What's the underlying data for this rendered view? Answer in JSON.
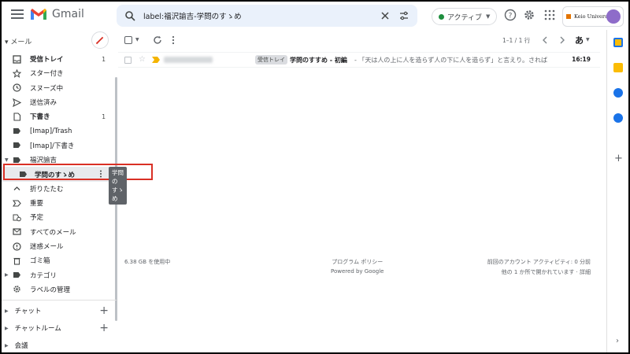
{
  "app": {
    "name": "Gmail"
  },
  "search": {
    "query": "label:福沢諭吉-学問のすゝめ"
  },
  "status": {
    "label": "アクティブ"
  },
  "account": {
    "org": "Keio University"
  },
  "sidebar": {
    "mail_label": "メール",
    "items": [
      {
        "label": "受信トレイ",
        "count": "1",
        "bold": true,
        "icon": "inbox-icon"
      },
      {
        "label": "スター付き",
        "count": "",
        "icon": "star-icon"
      },
      {
        "label": "スヌーズ中",
        "count": "",
        "icon": "clock-icon"
      },
      {
        "label": "送信済み",
        "count": "",
        "icon": "send-icon"
      },
      {
        "label": "下書き",
        "count": "1",
        "bold": true,
        "icon": "draft-icon"
      },
      {
        "label": "[Imap]/Trash",
        "count": "",
        "icon": "label-icon"
      },
      {
        "label": "[Imap]/下書き",
        "count": "",
        "icon": "label-icon"
      },
      {
        "label": "福沢諭吉",
        "count": "",
        "icon": "label-icon"
      },
      {
        "label": "学問のすゝめ",
        "count": "",
        "icon": "label-icon"
      },
      {
        "label": "折りたたむ",
        "count": "",
        "icon": "chevron-up-icon"
      },
      {
        "label": "重要",
        "count": "",
        "icon": "important-icon"
      },
      {
        "label": "予定",
        "count": "",
        "icon": "scheduled-icon"
      },
      {
        "label": "すべてのメール",
        "count": "",
        "icon": "all-mail-icon"
      },
      {
        "label": "迷惑メール",
        "count": "",
        "icon": "spam-icon"
      },
      {
        "label": "ゴミ箱",
        "count": "",
        "icon": "trash-icon"
      },
      {
        "label": "カテゴリ",
        "count": "",
        "icon": "label-icon"
      },
      {
        "label": "ラベルの管理",
        "count": "",
        "icon": "gear-icon"
      }
    ],
    "tooltip": "学問のすゝめ",
    "chat_label": "チャット",
    "chatroom_label": "チャットルーム",
    "meeting_label": "会議"
  },
  "toolbar": {
    "pagination": "1–1 / 1 行",
    "lang": "あ"
  },
  "messages": [
    {
      "chip": "受信トレイ",
      "subject": "学問のすすめ - 初編",
      "snippet": " - 「天は人の上に人を造らず人の下に人を造らず」と言えり。されば...",
      "time": "16:19"
    }
  ],
  "footer": {
    "storage": "6.38 GB を使用中",
    "policy": "プログラム ポリシー",
    "powered": "Powered by Google",
    "activity1": "前回のアカウント アクティビティ: 0 分前",
    "activity2": "他の 1 か所で開かれています · 詳細"
  },
  "colors": {
    "accent_red": "#d93025",
    "selected_bg": "#e8eaed",
    "active_green": "#1e8e3e"
  }
}
